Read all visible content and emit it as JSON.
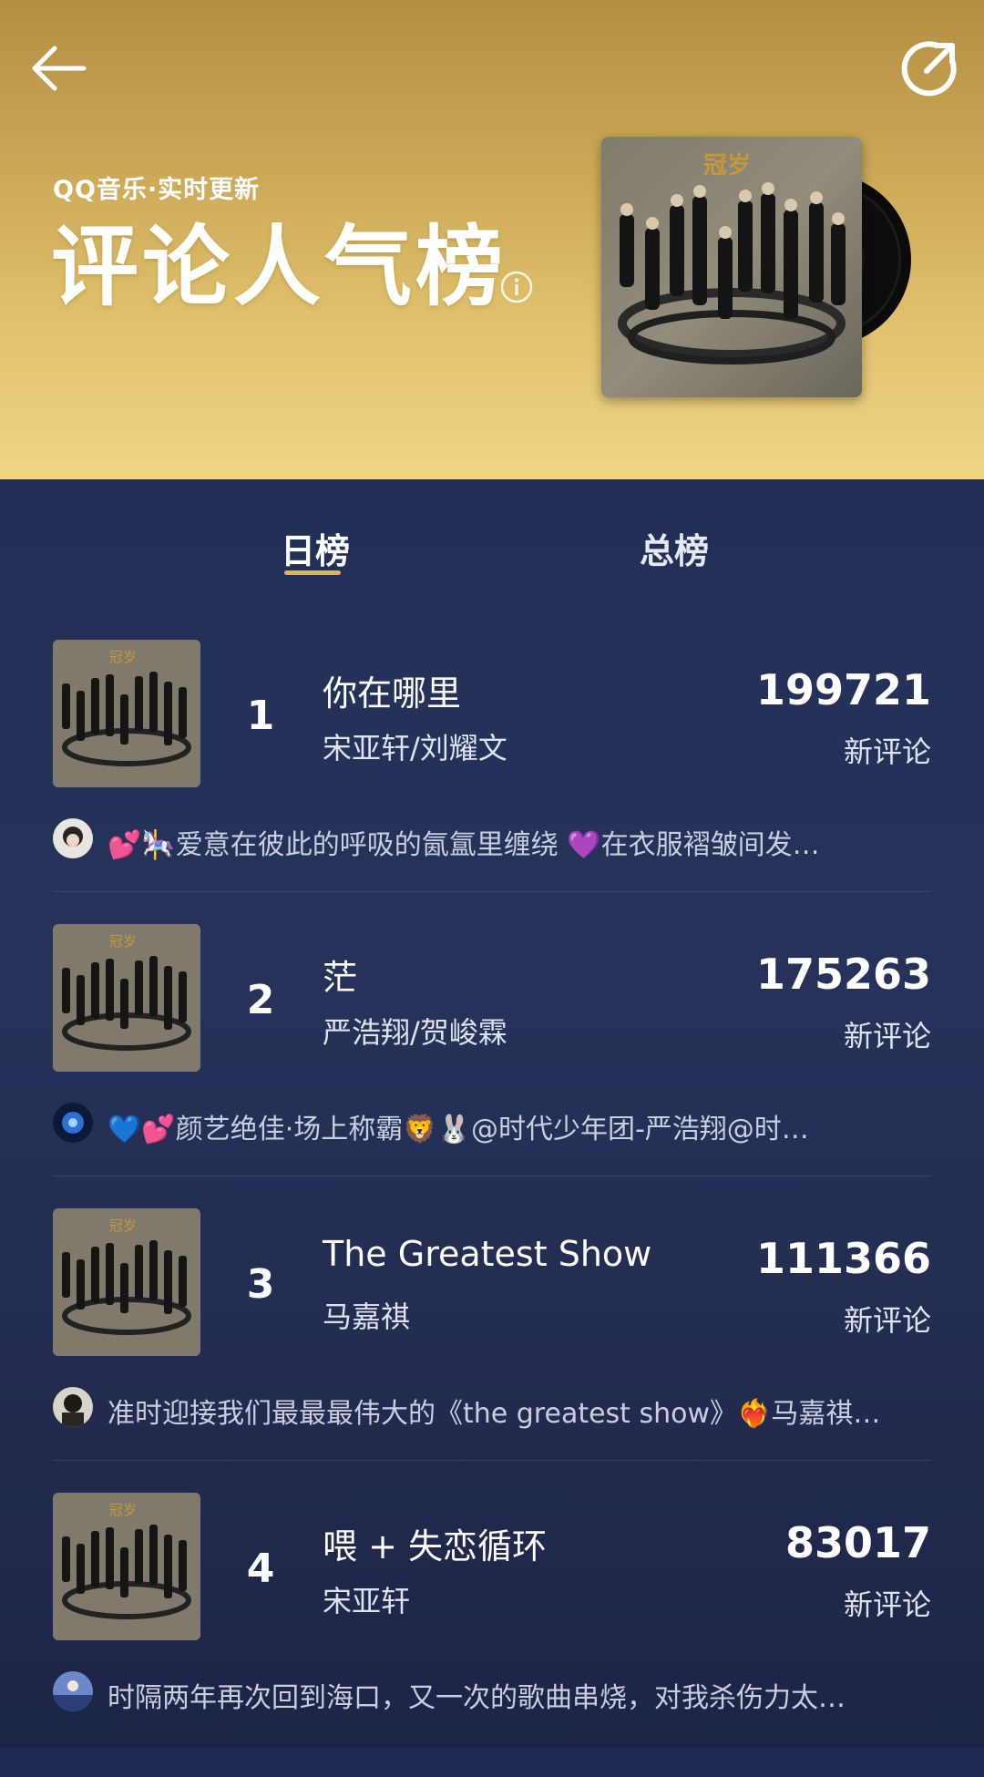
{
  "header": {
    "subtitle": "QQ音乐·实时更新",
    "title": "评论人气榜",
    "colors": {
      "gold_top": "#b28f43",
      "gold_bottom": "#f0d585",
      "navy": "#223058",
      "accent": "#d9b463"
    }
  },
  "tabs": [
    {
      "label": "日榜",
      "active": true
    },
    {
      "label": "总榜",
      "active": false
    }
  ],
  "entries": [
    {
      "rank": "1",
      "title": "你在哪里",
      "artist": "宋亚轩/刘耀文",
      "count": "199721",
      "count_label": "新评论",
      "comment": "💕🎠爱意在彼此的呼吸的氤氲里缠绕 💜在衣服褶皱间发…"
    },
    {
      "rank": "2",
      "title": "茫",
      "artist": "严浩翔/贺峻霖",
      "count": "175263",
      "count_label": "新评论",
      "comment": "💙💕颜艺绝佳·场上称霸🦁🐰@时代少年团-严浩翔@时…"
    },
    {
      "rank": "3",
      "title": "The Greatest Show",
      "artist": "马嘉祺",
      "count": "111366",
      "count_label": "新评论",
      "comment": "准时迎接我们最最最伟大的《the greatest show》❤️‍🔥马嘉祺…"
    },
    {
      "rank": "4",
      "title": "喂 + 失恋循环",
      "artist": "宋亚轩",
      "count": "83017",
      "count_label": "新评论",
      "comment": "时隔两年再次回到海口，又一次的歌曲串烧，对我杀伤力太…"
    }
  ]
}
